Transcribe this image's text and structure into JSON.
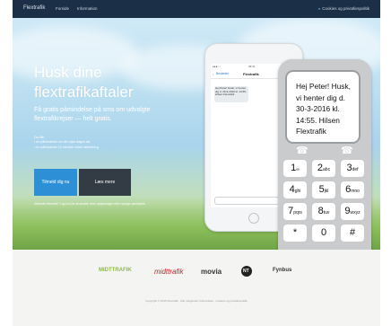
{
  "topbar": {
    "brand": "Flextrafik",
    "nav": [
      "Forside",
      "Information"
    ],
    "contact": "Cookies og privatlivspolitik"
  },
  "hero": {
    "headline_line1": "Husk dine",
    "headline_line2": "flextrafikaftaler",
    "subline": "Få gratis påmindelse på sms om udvalgte flextrafikrejser — helt gratis.",
    "perks_title": "Du får:",
    "perks": [
      "en påmindelse om din rejse dagen før",
      "en påmindelse 10 minutter inden afhentning"
    ],
    "primary_button": "Tilmeld dig nu",
    "secondary_button": "Læs mere",
    "login_note": "Allerede tilmeldt? Log ind for at ændre dine oplysninger eller opsige samtykke."
  },
  "smartphone": {
    "status_left": "●●●○○",
    "status_time": "09:41",
    "back_label": "Beskeder",
    "title": "Flextrafik",
    "message": "Hej Peter! Husk, vi henter dig d. 30-3-2016 kl. 14:55. Hilsen Flextrafik"
  },
  "dumbphone": {
    "sms": "Hej Peter! Husk, vi henter dig d. 30-3-2016 kl. 14:55. Hilsen Flextrafik",
    "keys": [
      [
        "1",
        "∞"
      ],
      [
        "2",
        "abc"
      ],
      [
        "3",
        "def"
      ],
      [
        "4",
        "ghi"
      ],
      [
        "5",
        "jkl"
      ],
      [
        "6",
        "mno"
      ],
      [
        "7",
        "pqrs"
      ],
      [
        "8",
        "tuv"
      ],
      [
        "9",
        "wxyz"
      ],
      [
        "*",
        ""
      ],
      [
        "0",
        ""
      ],
      [
        "#",
        ""
      ]
    ]
  },
  "partners": {
    "logo1": "MIDTTRAFIK",
    "logo2": "midttrafik",
    "logo3": "movia",
    "logo4": "NT",
    "logo5": "Fynbus"
  },
  "footer": {
    "text": "Copyright © 2016 Flextrafik · Alle rettigheder forbeholdes · Cookies og privatlivspolitik"
  }
}
